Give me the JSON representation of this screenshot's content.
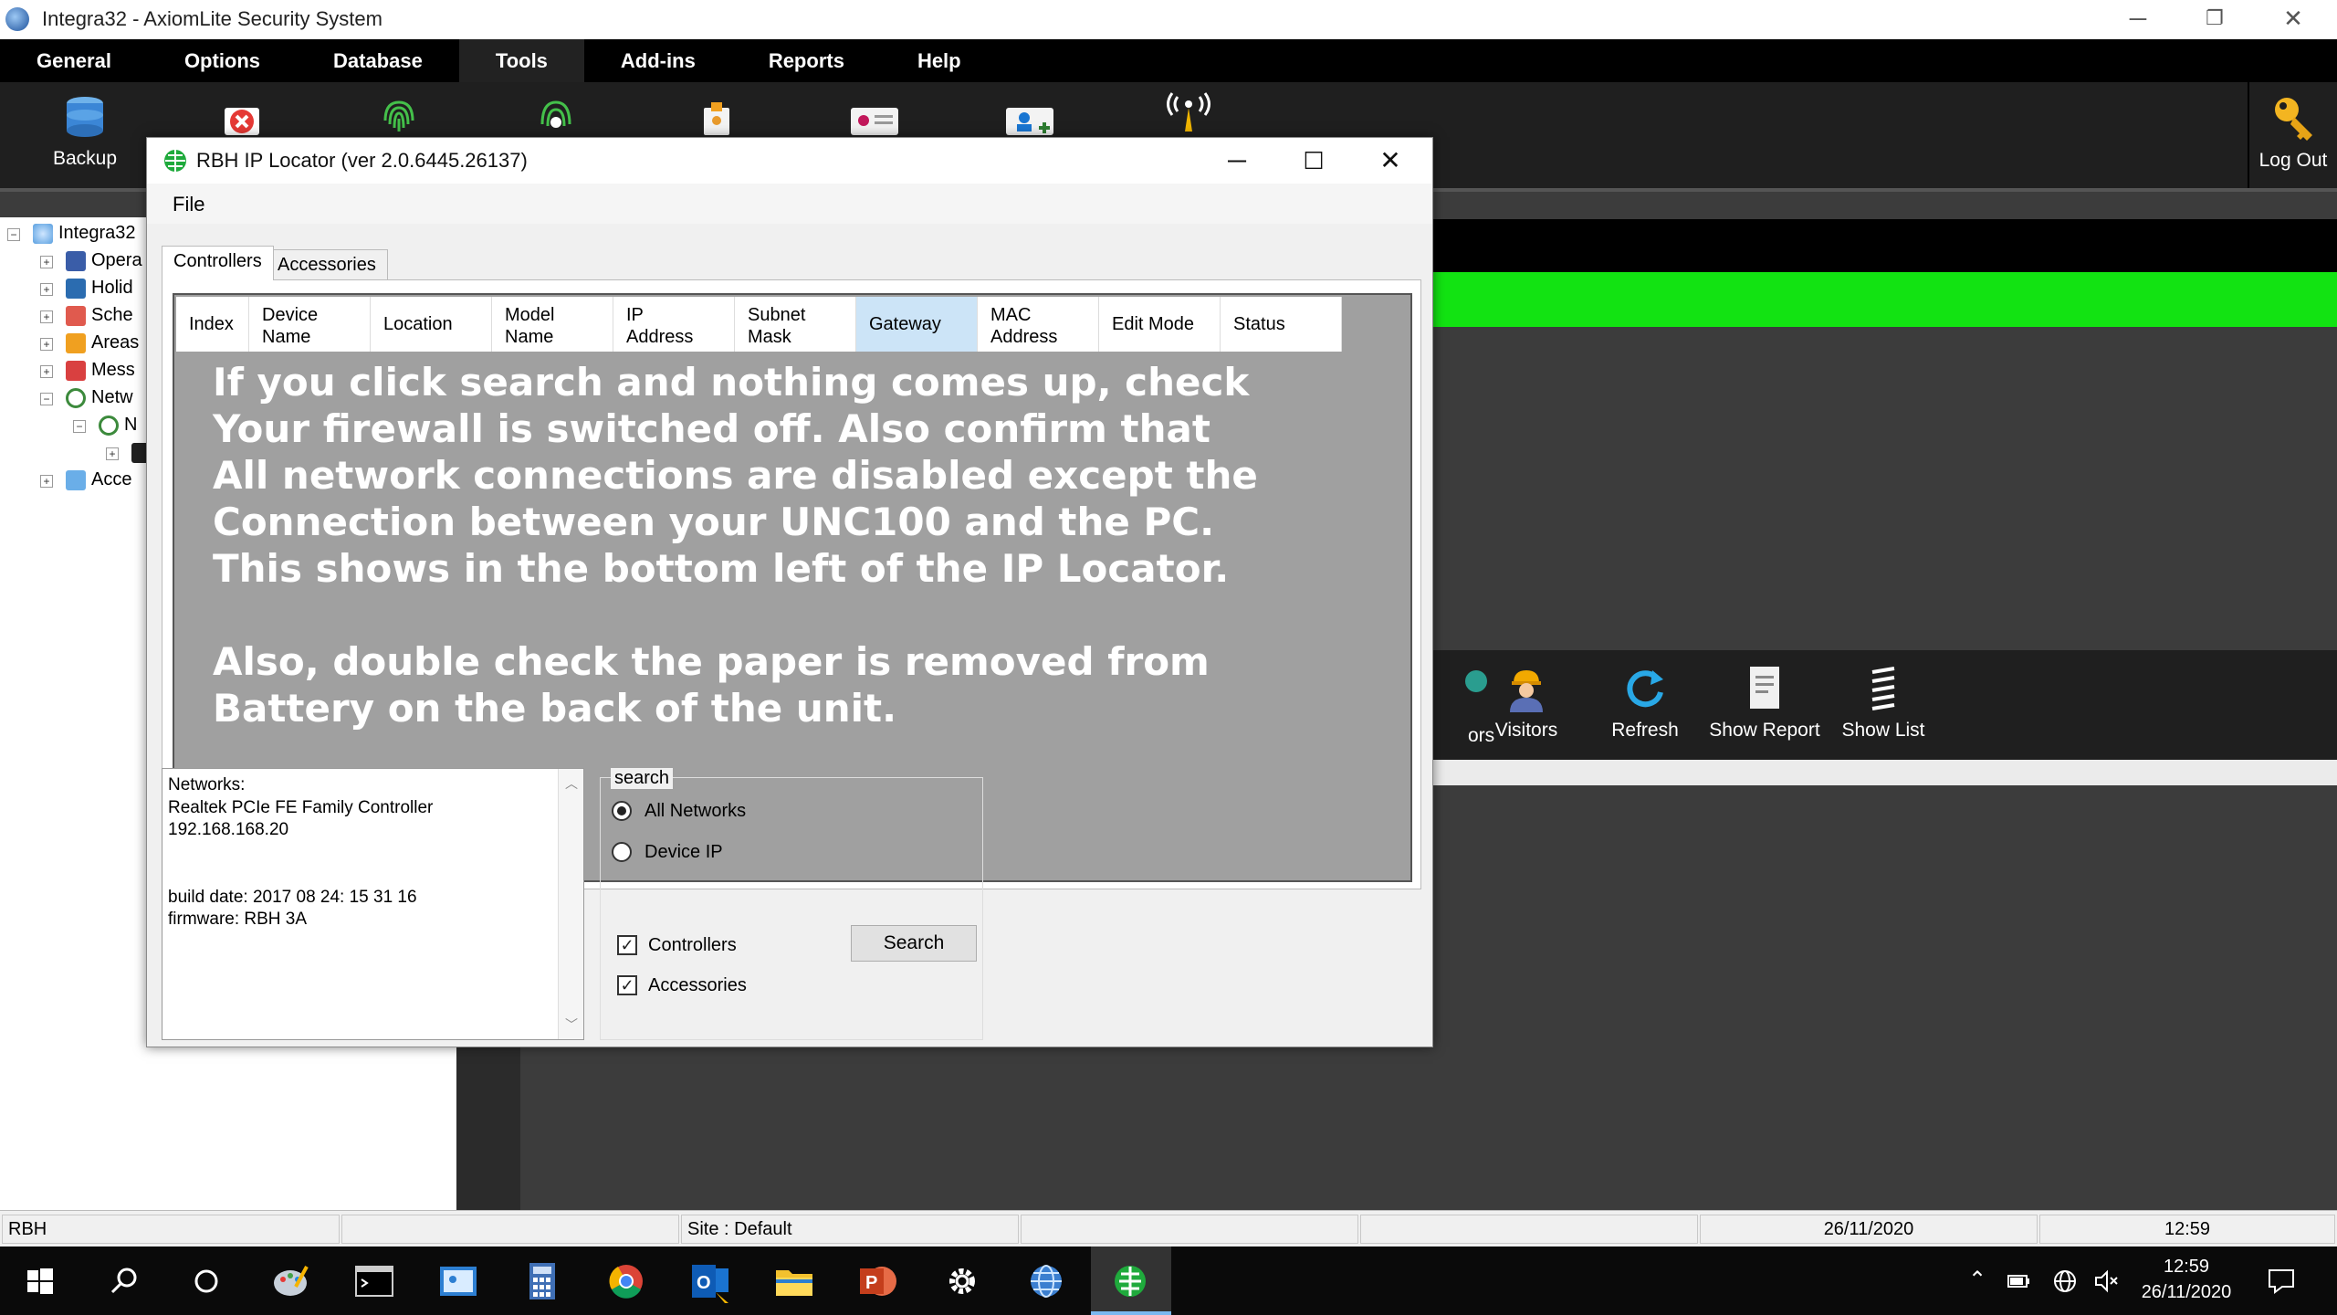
{
  "app": {
    "title": "Integra32 - AxiomLite Security System",
    "menu": [
      "General",
      "Options",
      "Database",
      "Tools",
      "Add-ins",
      "Reports",
      "Help"
    ],
    "active_menu": "Tools",
    "toolbar": {
      "backup_label": "Backup",
      "logout_label": "Log Out"
    },
    "actions": [
      {
        "label": "ors",
        "icon": "partial-icon"
      },
      {
        "label": "Visitors",
        "icon": "visitor-icon"
      },
      {
        "label": "Refresh",
        "icon": "refresh-icon"
      },
      {
        "label": "Show Report",
        "icon": "report-icon"
      },
      {
        "label": "Show List",
        "icon": "list-icon"
      }
    ],
    "tree": [
      {
        "label": "Integra32",
        "icon": "globe-icon"
      },
      {
        "label": "Opera",
        "icon": "operators-icon"
      },
      {
        "label": "Holid",
        "icon": "holidays-icon"
      },
      {
        "label": "Sche",
        "icon": "schedule-icon"
      },
      {
        "label": "Areas",
        "icon": "areas-icon"
      },
      {
        "label": "Mess",
        "icon": "messages-icon"
      },
      {
        "label": "Netw",
        "icon": "network-icon"
      },
      {
        "label": "N",
        "icon": "network-node-icon"
      },
      {
        "label": "",
        "icon": "device-icon"
      },
      {
        "label": "Acce",
        "icon": "access-icon"
      }
    ],
    "colors": {
      "green_band": "#12e312",
      "menu_bg": "#000000",
      "toolbar_bg": "#1f1f1f"
    }
  },
  "dialog": {
    "title": "RBH IP Locator (ver 2.0.6445.26137)",
    "menu_file": "File",
    "tabs": [
      "Controllers",
      "Accessories"
    ],
    "active_tab": "Controllers",
    "columns": [
      "Index",
      "Device\nName",
      "Location",
      "Model\nName",
      "IP\nAddress",
      "Subnet\nMask",
      "Gateway",
      "MAC\nAddress",
      "Edit Mode",
      "Status"
    ],
    "selected_column": "Gateway",
    "overlay_message": "If you click search and nothing comes up, check\nYour firewall is switched off. Also confirm that\nAll network connections are disabled except the\nConnection between your UNC100 and the PC.\nThis shows in the bottom left of the IP Locator.\n\nAlso, double check the paper is removed from\nBattery on the back of the unit.",
    "info_text": "Networks:\nRealtek PCIe FE Family Controller\n192.168.168.20\n\n\nbuild date: 2017 08 24: 15 31 16\nfirmware: RBH 3A",
    "search": {
      "legend": "search",
      "all_networks": "All Networks",
      "device_ip": "Device IP",
      "selected": "All Networks",
      "controllers": "Controllers",
      "accessories": "Accessories",
      "controllers_checked": true,
      "accessories_checked": true,
      "button": "Search"
    }
  },
  "statusbar": {
    "left": "RBH",
    "site": "Site : Default",
    "date": "26/11/2020",
    "time": "12:59"
  },
  "taskbar": {
    "clock_time": "12:59",
    "clock_date": "26/11/2020"
  }
}
